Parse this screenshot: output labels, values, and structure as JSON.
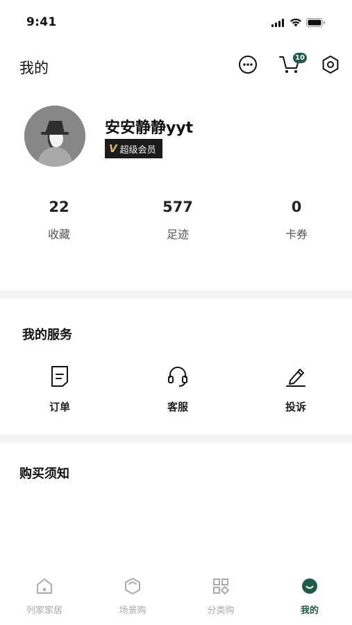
{
  "status_bar": {
    "time": "9:41",
    "icons": [
      "signal-icon",
      "wifi-icon",
      "battery-icon"
    ]
  },
  "header": {
    "title": "我的",
    "actions": [
      "more-icon",
      "cart-icon",
      "settings-icon"
    ],
    "cart_count": "10"
  },
  "profile": {
    "username": "安安静静yyt",
    "vip_mark": "V",
    "vip_label": "超级会员"
  },
  "stats": [
    {
      "value": "22",
      "label": "收藏"
    },
    {
      "value": "577",
      "label": "足迹"
    },
    {
      "value": "0",
      "label": "卡券"
    }
  ],
  "services": {
    "title": "我的服务",
    "items": [
      {
        "label": "订单",
        "icon": "order-icon"
      },
      {
        "label": "客服",
        "icon": "headset-icon"
      },
      {
        "label": "投诉",
        "icon": "edit-icon"
      }
    ]
  },
  "notice": {
    "title": "购买须知"
  },
  "tabbar": {
    "items": [
      {
        "label": "列家家居",
        "icon": "home-icon",
        "active": false
      },
      {
        "label": "场景购",
        "icon": "scene-icon",
        "active": false
      },
      {
        "label": "分类购",
        "icon": "category-icon",
        "active": false
      },
      {
        "label": "我的",
        "icon": "profile-icon",
        "active": true
      }
    ]
  },
  "colors": {
    "accent": "#1f5c47",
    "badge_bg": "#1c1c1c",
    "vip_gold": "#d9b86a",
    "separator": "#f4f4f4"
  }
}
